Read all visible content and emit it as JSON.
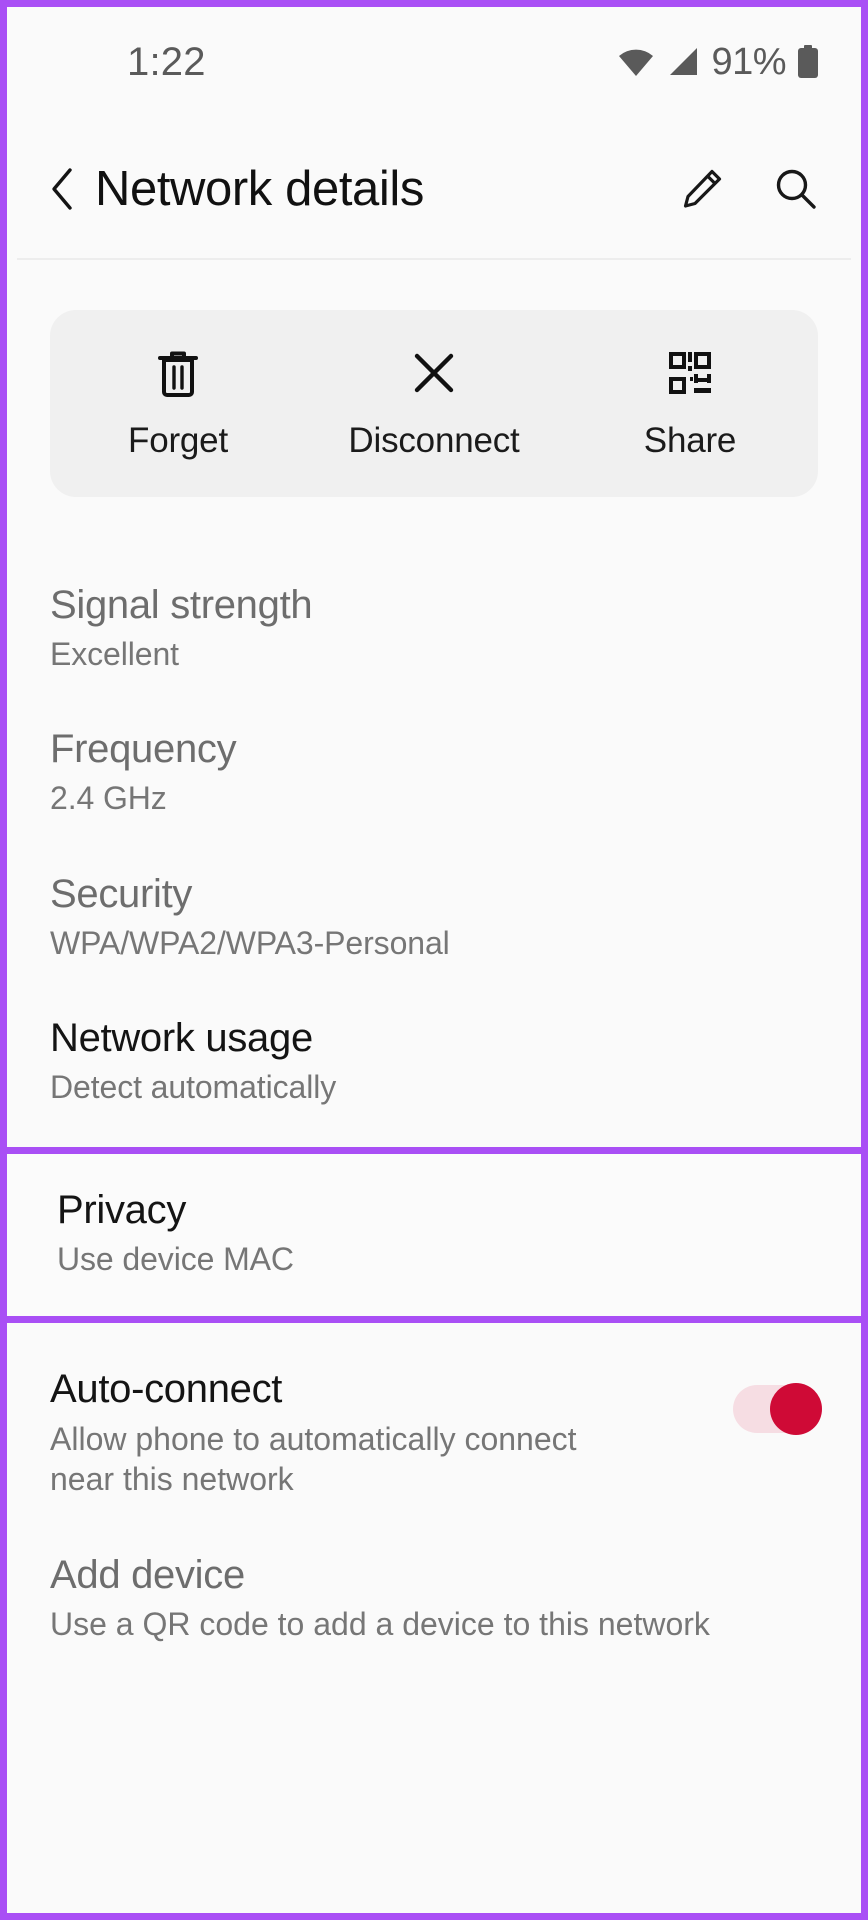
{
  "status_bar": {
    "time": "1:22",
    "battery_percent": "91%",
    "wifi_icon": "wifi-icon",
    "signal_icon": "cellular-signal-icon",
    "battery_icon": "battery-icon"
  },
  "app_bar": {
    "back_icon": "back-chevron-icon",
    "title": "Network details",
    "edit_icon": "pencil-edit-icon",
    "search_icon": "search-icon"
  },
  "action_card": {
    "buttons": [
      {
        "label": "Forget",
        "icon": "trash-icon"
      },
      {
        "label": "Disconnect",
        "icon": "close-x-icon"
      },
      {
        "label": "Share",
        "icon": "qr-code-icon"
      }
    ]
  },
  "details": {
    "signal_strength": {
      "title": "Signal strength",
      "value": "Excellent"
    },
    "frequency": {
      "title": "Frequency",
      "value": "2.4 GHz"
    },
    "security": {
      "title": "Security",
      "value": "WPA/WPA2/WPA3-Personal"
    },
    "network_usage": {
      "title": "Network usage",
      "value": "Detect automatically"
    },
    "privacy": {
      "title": "Privacy",
      "value": "Use device MAC"
    },
    "auto_connect": {
      "title": "Auto-connect",
      "description": "Allow phone to automatically connect near this network",
      "toggle_state": "on"
    },
    "add_device": {
      "title": "Add device",
      "value": "Use a QR code to add a device to this network"
    }
  },
  "colors": {
    "highlight_purple": "#a94ff5",
    "toggle_on_thumb": "#cf0a36",
    "toggle_on_track": "#f6dde3",
    "card_background": "#f0f0f0",
    "page_background": "#fafafa"
  }
}
